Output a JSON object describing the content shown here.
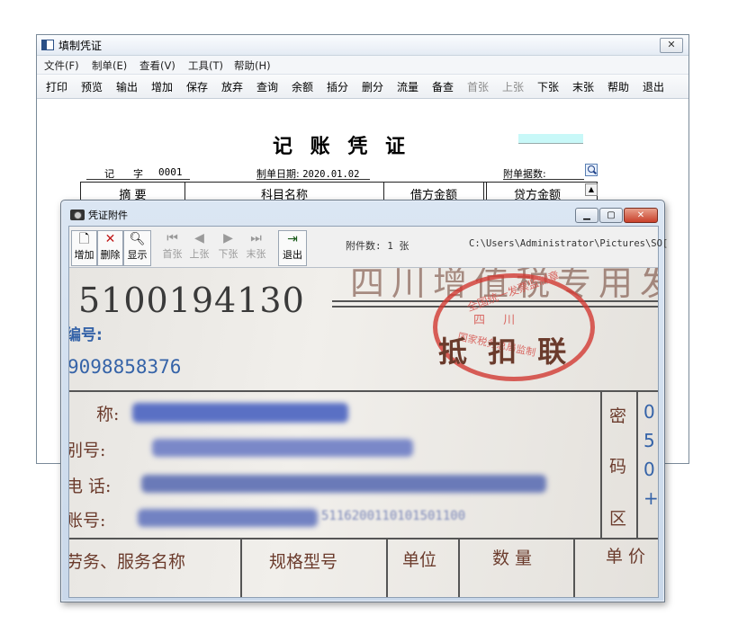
{
  "main_window": {
    "title": "填制凭证",
    "close_glyph": "✕",
    "menu": [
      "文件(F)",
      "制单(E)",
      "查看(V)",
      "工具(T)",
      "帮助(H)"
    ],
    "toolbar": [
      "打印",
      "预览",
      "输出",
      "增加",
      "保存",
      "放弃",
      "查询",
      "余额",
      "插分",
      "删分",
      "流量",
      "备查",
      "首张",
      "上张",
      "下张",
      "末张",
      "帮助",
      "退出"
    ],
    "voucher_title": "记 账 凭 证",
    "voucher_type": "记",
    "voucher_char": "字",
    "voucher_no": "0001",
    "date_label": "制单日期:",
    "date_value": "2020.01.02",
    "attach_label": "附单据数:",
    "columns": [
      "摘 要",
      "科目名称",
      "借方金额",
      "贷方金额"
    ]
  },
  "attachment_window": {
    "title": "凭证附件",
    "buttons": {
      "add": "增加",
      "delete": "删除",
      "show": "显示",
      "first": "首张",
      "prev": "上张",
      "next": "下张",
      "last": "末张",
      "exit": "退出"
    },
    "count_text": "附件数: 1 张",
    "path": "C:\\Users\\Administrator\\Pictures\\SO["
  },
  "invoice_image": {
    "code": "5100194130",
    "header": "四川增值税专用发票",
    "stamp_text": "全国统一发票监制章",
    "stamp_region": "四 川",
    "stamp_bureau": "国家税务总局监制",
    "copy_type": "抵 扣 联",
    "no_label": "编号:",
    "no_value": "9098858376",
    "name_label": "称:",
    "taxid_label": "别号:",
    "phone_label": "电 话:",
    "account_label": "账号:",
    "account_tail": "5116200110101501100",
    "secret_labels": [
      "密",
      "码",
      "区"
    ],
    "secret_chars": [
      "0",
      "5",
      "0",
      "+"
    ],
    "items_cols": [
      "劳务、服务名称",
      "规格型号",
      "单位",
      "数 量",
      "单 价"
    ]
  },
  "colors": {
    "accent": "#c8f8f8",
    "stamp_red": "#d23a33",
    "ink_blue": "#3563a8"
  }
}
